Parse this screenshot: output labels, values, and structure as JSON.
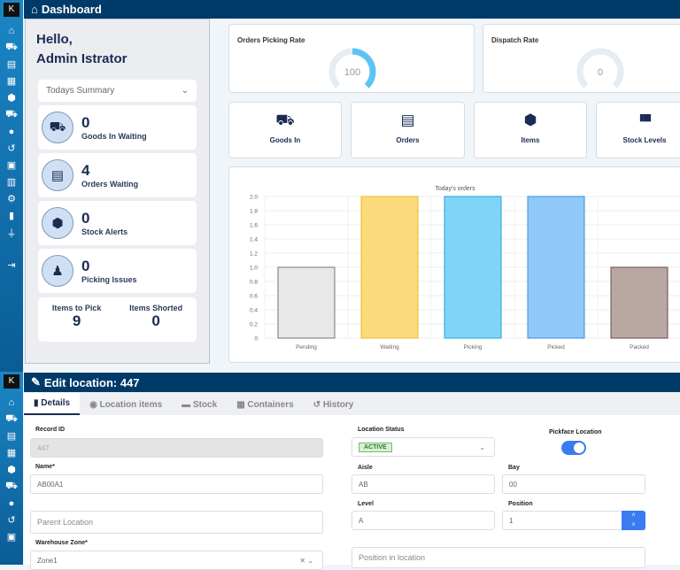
{
  "sidebar_icons": [
    "home",
    "goods-in",
    "orders",
    "containers",
    "items",
    "delivery",
    "location",
    "returns",
    "contacts",
    "warehouse",
    "settings",
    "battery",
    "plugin",
    "logout"
  ],
  "dashboard": {
    "title": "Dashboard",
    "greeting": "Hello,",
    "user": "Admin Istrator",
    "summary_select": "Todays Summary",
    "stats": [
      {
        "value": "0",
        "label": "Goods In Waiting"
      },
      {
        "value": "4",
        "label": "Orders Waiting"
      },
      {
        "value": "0",
        "label": "Stock Alerts"
      },
      {
        "value": "0",
        "label": "Picking Issues"
      }
    ],
    "items_to_pick_label": "Items to Pick",
    "items_to_pick": "9",
    "items_shorted_label": "Items Shorted",
    "items_shorted": "0",
    "picking_rate": {
      "title": "Orders Picking Rate",
      "value": "100",
      "fraction": 0.5
    },
    "dispatch_rate": {
      "title": "Dispatch Rate",
      "value": "0",
      "fraction": 0
    },
    "quick_links": [
      {
        "label": "Goods In",
        "icon": "⛟"
      },
      {
        "label": "Orders",
        "icon": "▤"
      },
      {
        "label": "Items",
        "icon": "⬢"
      },
      {
        "label": "Stock Levels",
        "icon": "▮▮▮"
      }
    ]
  },
  "chart_data": {
    "type": "bar",
    "title": "Today's orders",
    "categories": [
      "Pending",
      "Waiting",
      "Picking",
      "Picked",
      "Packed"
    ],
    "values": [
      1,
      2,
      2,
      2,
      1
    ],
    "colors": [
      "#e8e8e8",
      "#fcd97a",
      "#7fd4f8",
      "#90c8f8",
      "#b9a8a2"
    ],
    "borders": [
      "#888888",
      "#f0c040",
      "#3aaee0",
      "#4a9ee0",
      "#7a6060"
    ],
    "ylim": [
      0,
      2
    ],
    "yticks": [
      "0",
      "0.2",
      "0.4",
      "0.6",
      "0.8",
      "1.0",
      "1.2",
      "1.4",
      "1.6",
      "1.8",
      "2.0"
    ]
  },
  "edit": {
    "title": "Edit location: 447",
    "tabs": [
      "Details",
      "Location items",
      "Stock",
      "Containers",
      "History"
    ],
    "record_id_label": "Record ID",
    "record_id": "447",
    "name_label": "Name*",
    "name": "AB00A1",
    "parent_placeholder": "Parent Location",
    "zone_label": "Warehouse Zone*",
    "zone": "Zone1",
    "status_label": "Location Status",
    "status": "ACTIVE",
    "pickface_label": "Pickface Location",
    "pickface": true,
    "aisle_label": "Aisle",
    "aisle": "AB",
    "bay_label": "Bay",
    "bay": "00",
    "level_label": "Level",
    "level": "A",
    "position_label": "Position",
    "position": "1",
    "position_in_location_placeholder": "Position in location"
  }
}
